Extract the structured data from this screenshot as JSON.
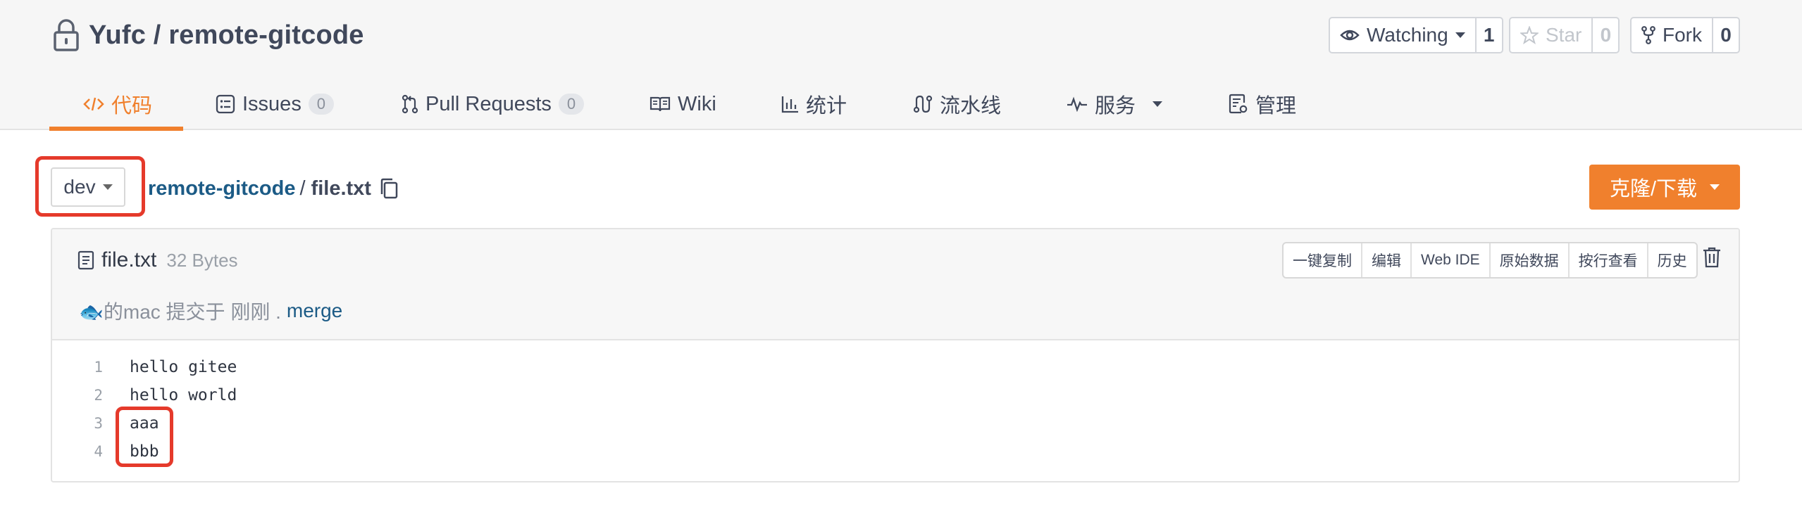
{
  "repo": {
    "title": "Yufc / remote-gitcode"
  },
  "actions": {
    "watch": {
      "label": "Watching",
      "count": "1"
    },
    "star": {
      "label": "Star",
      "count": "0"
    },
    "fork": {
      "label": "Fork",
      "count": "0"
    }
  },
  "tabs": [
    {
      "label": "代码",
      "icon": "code-icon"
    },
    {
      "label": "Issues",
      "icon": "issues-icon",
      "badge": "0"
    },
    {
      "label": "Pull Requests",
      "icon": "pull-request-icon",
      "badge": "0"
    },
    {
      "label": "Wiki",
      "icon": "wiki-book-icon"
    },
    {
      "label": "统计",
      "icon": "bar-chart-icon"
    },
    {
      "label": "流水线",
      "icon": "pipeline-icon"
    },
    {
      "label": "服务",
      "icon": "pulse-icon"
    },
    {
      "label": "管理",
      "icon": "settings-doc-icon"
    }
  ],
  "breadcrumb": {
    "branch": "dev",
    "repo": "remote-gitcode",
    "separator": "/",
    "file": "file.txt"
  },
  "clone": {
    "label": "克隆/下载"
  },
  "file": {
    "name": "file.txt",
    "size": "32 Bytes",
    "author": "🐟的mac 提交于 刚刚 .",
    "commit_message": "merge",
    "buttons": [
      "一键复制",
      "编辑",
      "Web IDE",
      "原始数据",
      "按行查看",
      "历史"
    ]
  },
  "code": [
    {
      "n": "1",
      "text": "hello gitee"
    },
    {
      "n": "2",
      "text": "hello world"
    },
    {
      "n": "3",
      "text": "aaa"
    },
    {
      "n": "4",
      "text": "bbb"
    }
  ],
  "colors": {
    "accent": "#f0802d",
    "link": "#1c5b86",
    "highlight": "#e53a2b"
  }
}
